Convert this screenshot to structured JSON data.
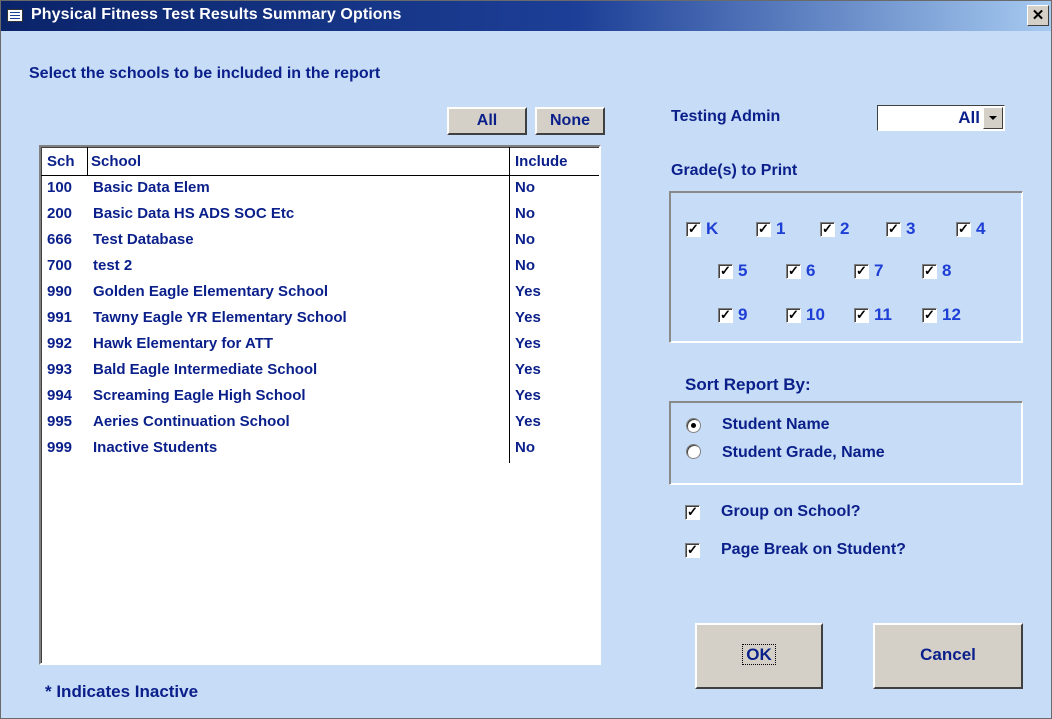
{
  "window": {
    "title": "Physical Fitness Test Results Summary Options",
    "close_glyph": "✕"
  },
  "instructions": "Select the schools to be included in the report",
  "buttons": {
    "all": "All",
    "none": "None",
    "ok": "OK",
    "cancel": "Cancel"
  },
  "schools": {
    "headers": {
      "sch": "Sch",
      "school": "School",
      "include": "Include"
    },
    "rows": [
      {
        "sch": "100",
        "school": "Basic Data Elem",
        "include": "No"
      },
      {
        "sch": "200",
        "school": "Basic Data HS ADS SOC Etc",
        "include": "No"
      },
      {
        "sch": "666",
        "school": "Test Database",
        "include": "No"
      },
      {
        "sch": "700",
        "school": " test 2",
        "include": "No"
      },
      {
        "sch": "990",
        "school": "Golden Eagle Elementary School",
        "include": "Yes"
      },
      {
        "sch": "991",
        "school": "Tawny Eagle YR Elementary School",
        "include": "Yes"
      },
      {
        "sch": "992",
        "school": "Hawk Elementary for ATT",
        "include": "Yes"
      },
      {
        "sch": "993",
        "school": "Bald Eagle Intermediate School",
        "include": "Yes"
      },
      {
        "sch": "994",
        "school": "Screaming Eagle High School",
        "include": "Yes"
      },
      {
        "sch": "995",
        "school": "Aeries Continuation School",
        "include": "Yes"
      },
      {
        "sch": "999",
        "school": "Inactive Students",
        "include": "No"
      }
    ]
  },
  "footnote": "* Indicates Inactive",
  "testing_admin": {
    "label": "Testing Admin",
    "value": "All"
  },
  "grades": {
    "label": "Grade(s) to Print",
    "items": [
      {
        "label": "K",
        "checked": true
      },
      {
        "label": "1",
        "checked": true
      },
      {
        "label": "2",
        "checked": true
      },
      {
        "label": "3",
        "checked": true
      },
      {
        "label": "4",
        "checked": true
      },
      {
        "label": "5",
        "checked": true
      },
      {
        "label": "6",
        "checked": true
      },
      {
        "label": "7",
        "checked": true
      },
      {
        "label": "8",
        "checked": true
      },
      {
        "label": "9",
        "checked": true
      },
      {
        "label": "10",
        "checked": true
      },
      {
        "label": "11",
        "checked": true
      },
      {
        "label": "12",
        "checked": true
      }
    ]
  },
  "sort": {
    "label": "Sort Report By:",
    "options": [
      {
        "label": "Student Name",
        "selected": true
      },
      {
        "label": "Student Grade, Name",
        "selected": false
      }
    ]
  },
  "options": {
    "group_on_school": {
      "label": "Group on School?",
      "checked": true
    },
    "page_break": {
      "label": "Page Break on Student?",
      "checked": true
    }
  },
  "check_glyph": "✓",
  "colors": {
    "background": "#c7dcf6",
    "title_bar": "#0a246a",
    "text": "#0a1f8a",
    "grade_text": "#1e3fd6",
    "button_face": "#d4d0c8"
  }
}
